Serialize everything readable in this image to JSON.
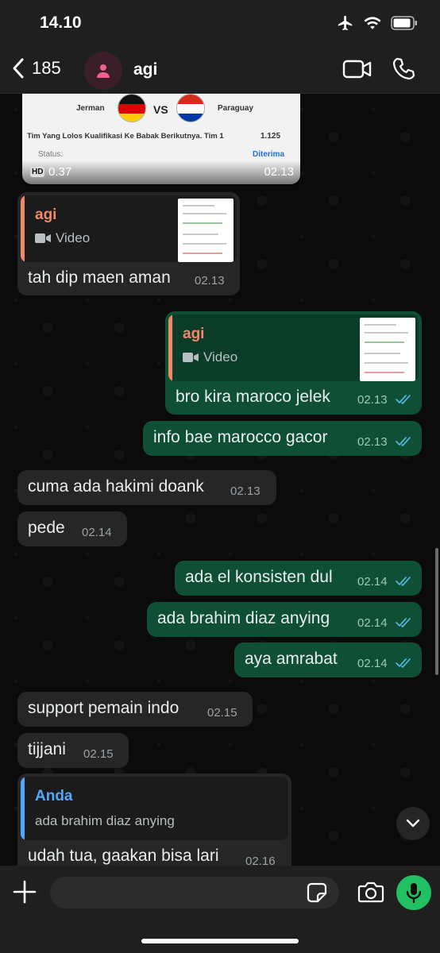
{
  "status_bar": {
    "time": "14.10"
  },
  "header": {
    "back_count": "185",
    "contact_name": "agi"
  },
  "image_card": {
    "team_left": "Jerman",
    "vs": "VS",
    "team_right": "Paraguay",
    "bet_title": "Tim Yang Lolos Kualifikasi Ke Babak Berikutnya. Tim 1",
    "odds": "1.125",
    "status_label": "Status:",
    "status_value": "Diterima",
    "hd_badge": "HD",
    "size": "0.37",
    "time": "02.13"
  },
  "messages": [
    {
      "id": "m1",
      "text": "tah dip maen aman",
      "time": "02.13",
      "quote": {
        "name": "agi",
        "type": "Video"
      }
    },
    {
      "id": "m2",
      "text": "bro kira maroco jelek",
      "time": "02.13",
      "quote": {
        "name": "agi",
        "type": "Video"
      }
    },
    {
      "id": "m3",
      "text": "info bae marocco gacor",
      "time": "02.13"
    },
    {
      "id": "m4",
      "text": "cuma ada hakimi doank",
      "time": "02.13"
    },
    {
      "id": "m5",
      "text": "pede",
      "time": "02.14"
    },
    {
      "id": "m6",
      "text": "ada el konsisten dul",
      "time": "02.14"
    },
    {
      "id": "m7",
      "text": "ada brahim diaz anying",
      "time": "02.14"
    },
    {
      "id": "m8",
      "text": "aya amrabat",
      "time": "02.14"
    },
    {
      "id": "m9",
      "text": "support pemain indo",
      "time": "02.15"
    },
    {
      "id": "m10",
      "text": "tijjani",
      "time": "02.15"
    },
    {
      "id": "m11",
      "text": "udah tua, gaakan bisa lari",
      "time": "02.16",
      "quote": {
        "name": "Anda",
        "text": "ada brahim diaz anying"
      }
    }
  ],
  "input": {
    "placeholder": ""
  },
  "colors": {
    "incoming_bubble": "#262626",
    "outgoing_bubble": "#0f4f36",
    "quote_agi": "#f0886b",
    "quote_you": "#53a6fb",
    "read_ticks": "#53bdeb",
    "mic_button": "#21c063"
  }
}
